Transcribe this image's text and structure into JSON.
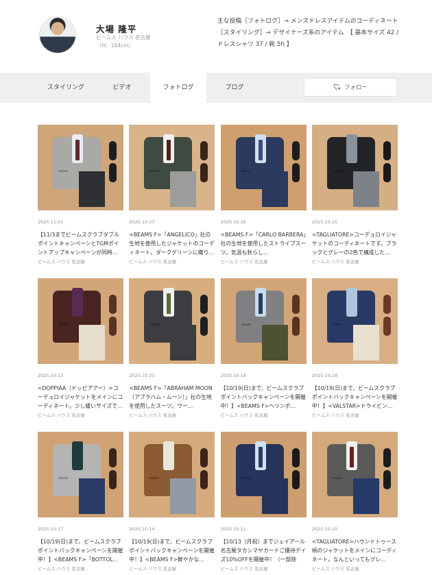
{
  "profile": {
    "name": "大場 隆平",
    "shop": "ビームス ハウス 名古屋",
    "height": "（H：164cm）",
    "intro": "主な投稿［フォトログ］→ メンズドレスアイテムのコーディネート［スタイリング］→ デザイナーズ系のアイテム　【 基本サイズ 42 / ドレスシャツ 37 / 靴 5h 】"
  },
  "tabs": [
    "スタイリング",
    "ビデオ",
    "フォトログ",
    "ブログ"
  ],
  "active_tab": "フォトログ",
  "follow_label": "フォロー",
  "posts": [
    {
      "date": "2025.11.01",
      "caption": "【11/3までビームスクラブダブルポイントキャンペーンとTGMポイントアップキャンペーンが同時…",
      "shop": "ビームス ハウス 名古屋",
      "bg": "#cfa57a",
      "jacket": "#a9a9a6",
      "shirt": "#e8ecf1",
      "tie": "#5a2a2a",
      "pants": "#2d2f33",
      "shoe": "#1d1d1d"
    },
    {
      "date": "2025.10.27",
      "caption": "<BEAMS F>「ANGELICO」社の生地を使用したジャケットのコーディネート。ダークグリーンに織り…",
      "shop": "ビームス ハウス 名古屋",
      "bg": "#d9b38a",
      "jacket": "#3f4a41",
      "shirt": "#f2f2f0",
      "tie": "#4d2420",
      "pants": "#9c9c9a",
      "shoe": "#3a2418"
    },
    {
      "date": "2025.10.26",
      "caption": "<BEAMS F>「CARLO BARBERA」社の生地を使用したストライプスーツ。気温も秋らし…",
      "shop": "ビームス ハウス 名古屋",
      "bg": "#cf9f6e",
      "jacket": "#2b3a5e",
      "shirt": "#cfe0f2",
      "tie": "#3b4e7a",
      "pants": "#2b3a5e",
      "shoe": "#1c1c1c"
    },
    {
      "date": "2025.10.25",
      "caption": "<TAGLIATORE>コーデュロイジャケットのコーディネートです。ブラックとグレーの2色で構成した…",
      "shop": "ビームス ハウス 名古屋",
      "bg": "#d6ae84",
      "jacket": "#232428",
      "shirt": "#8a929c",
      "tie": "#8a929c",
      "pants": "#7c8288",
      "shoe": "#1a1a1a"
    },
    {
      "date": "2025.10.23",
      "caption": "<DOPPIAA（ドッピアアー）>コーデュロイジャケットをメインにコーディネート。少し緩いサイズで…",
      "shop": "ビームス ハウス 名古屋",
      "bg": "#d3a67a",
      "jacket": "#4a2420",
      "shirt": "#5b2a52",
      "tie": "#5b2a52",
      "pants": "#e6ddcc",
      "shoe": "#5a3222"
    },
    {
      "date": "2025.10.21",
      "caption": "<BEAMS F>「ABRAHAM MOON（アブラハム・ムーン）」社の生地を使用したスーツ。ウー…",
      "shop": "ビームス ハウス 名古屋",
      "bg": "#d7ae80",
      "jacket": "#3c3d40",
      "shirt": "#f0f0ee",
      "tie": "#5a6a3a",
      "pants": "#3c3d40",
      "shoe": "#1e1e1e"
    },
    {
      "date": "2025.10.19",
      "caption": "【10/19(日)まで、ビームスクラブポイントバックキャンペーンを開催中！】<BEAMS F>ヘリンボ…",
      "shop": "ビームス ハウス 名古屋",
      "bg": "#d2a576",
      "jacket": "#808082",
      "shirt": "#c9dbef",
      "tie": "#2c3a5a",
      "pants": "#4e5233",
      "shoe": "#5a3420"
    },
    {
      "date": "2025.10.18",
      "caption": "【10/19(日)まで、ビームスクラブポイントバックキャンペーンを開催中！】<VALSTAR>ドライビン…",
      "shop": "ビームス ハウス 名古屋",
      "bg": "#d8af84",
      "jacket": "#2a3a66",
      "shirt": "#aec5df",
      "tie": "#aec5df",
      "pants": "#e9e1cf",
      "shoe": "#6b3a22"
    },
    {
      "date": "2025.10.17",
      "caption": "【10/19(日)まで、ビームスクラブポイントバックキャンペーンを開催中！】<BEAMS F>「BOTTOL…",
      "shop": "ビームス ハウス 名古屋",
      "bg": "#d0a274",
      "jacket": "#b4b4b2",
      "shirt": "#1f3a3a",
      "tie": "#1f3a3a",
      "pants": "#2a3c66",
      "shoe": "#3a2418"
    },
    {
      "date": "2025.10.14",
      "caption": "【10/19(日)まで、ビームスクラブポイントバックキャンペーンを開催中！】<BEAMS F>鮮やかな…",
      "shop": "ビームス ハウス 名古屋",
      "bg": "#d5ab7e",
      "jacket": "#8a5a32",
      "shirt": "#ece6da",
      "tie": "#ece6da",
      "pants": "#8f9aa6",
      "shoe": "#3b2418"
    },
    {
      "date": "2025.10.11",
      "caption": "【10/13（月祝）までジェイアール名古屋タカシマヤカードご優待デイズ10%OFFを開催中！（一部除外…",
      "shop": "ビームス ハウス 名古屋",
      "bg": "#cd9e70",
      "jacket": "#27335a",
      "shirt": "#cfe0f2",
      "tie": "#2a3a62",
      "pants": "#27335a",
      "shoe": "#1a1a1a"
    },
    {
      "date": "2025.10.10",
      "caption": "<TAGLIATORE>ハウンドトゥース柄のジャケットをメインにコーディネート。なんといってもグレ…",
      "shop": "ビームス ハウス 名古屋",
      "bg": "#d4aa7c",
      "jacket": "#5a5a58",
      "shirt": "#f0f0ee",
      "tie": "#6a1f1f",
      "pants": "#263a66",
      "shoe": "#1c1c1c"
    }
  ]
}
